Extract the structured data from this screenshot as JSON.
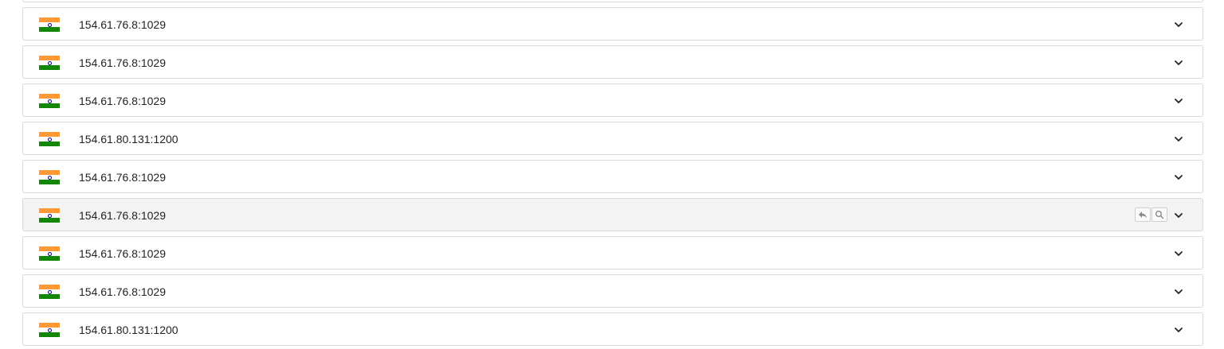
{
  "rows": [
    {
      "address": "154.61.76.8:1029",
      "flag": "india-flag-icon"
    },
    {
      "address": "154.61.76.8:1029",
      "flag": "india-flag-icon"
    },
    {
      "address": "154.61.76.8:1029",
      "flag": "india-flag-icon"
    },
    {
      "address": "154.61.80.131:1200",
      "flag": "india-flag-icon"
    },
    {
      "address": "154.61.76.8:1029",
      "flag": "india-flag-icon"
    },
    {
      "address": "154.61.76.8:1029",
      "flag": "india-flag-icon",
      "hover_actions": [
        "reply-icon",
        "search-icon"
      ]
    },
    {
      "address": "154.61.76.8:1029",
      "flag": "india-flag-icon"
    },
    {
      "address": "154.61.76.8:1029",
      "flag": "india-flag-icon"
    },
    {
      "address": "154.61.80.131:1200",
      "flag": "india-flag-icon"
    }
  ],
  "colors": {
    "saffron": "#ff9933",
    "green": "#138808",
    "chakra": "#000080",
    "row_border": "#d9d9d9",
    "row_hover_bg": "#f3f3f3"
  }
}
